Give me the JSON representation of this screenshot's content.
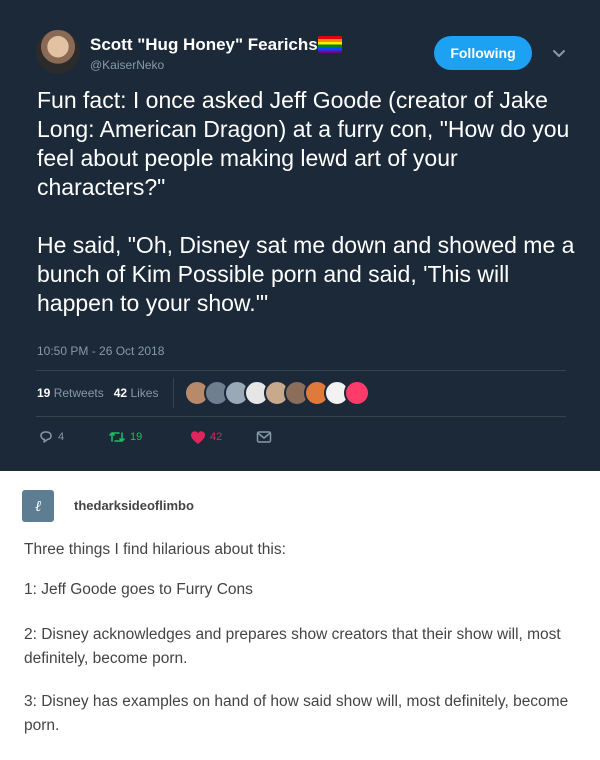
{
  "tweet": {
    "display_name": "Scott \"Hug Honey\" Fearichs",
    "handle": "@KaiserNeko",
    "follow_label": "Following",
    "text": [
      "Fun fact: I once asked Jeff Goode (creator of Jake Long: American Dragon) at a furry con, \"How do you feel about people making lewd art of your characters?\"",
      "He said, \"Oh, Disney sat me down and showed me a bunch of Kim Possible porn and said, 'This will happen to your show.'\""
    ],
    "timestamp": "10:50 PM - 26 Oct 2018",
    "retweet_count": "19",
    "retweets_label": "Retweets",
    "like_count": "42",
    "likes_label": "Likes",
    "reply_count": "4",
    "action_retweet_count": "19",
    "action_like_count": "42",
    "likers": [
      "#b98a6a",
      "#6f7f8f",
      "#9aa9b8",
      "#e6e6e6",
      "#c9a98b",
      "#8a6d5a",
      "#e07a3a",
      "#f2f2f2",
      "#ff3b6b"
    ],
    "icons": {
      "flag": "rainbow-flag-icon",
      "chevron": "chevron-down-icon",
      "reply": "reply-icon",
      "retweet": "retweet-icon",
      "like": "heart-icon",
      "dm": "envelope-icon"
    },
    "colors": {
      "background": "#1c2938",
      "accent": "#1da1f2",
      "retweet": "#17bf63",
      "like": "#e0245e",
      "muted": "#8899a6"
    }
  },
  "tumblr_post": {
    "username": "thedarksideoflimbo",
    "avatar_glyph": "ℓ",
    "lines": [
      "Three things I find hilarious about this:",
      "1: Jeff Goode goes to Furry Cons",
      "2: Disney acknowledges and prepares show creators that their show will, most definitely, become porn.",
      "3: Disney has examples on hand of how said show will, most definitely, become porn."
    ]
  }
}
